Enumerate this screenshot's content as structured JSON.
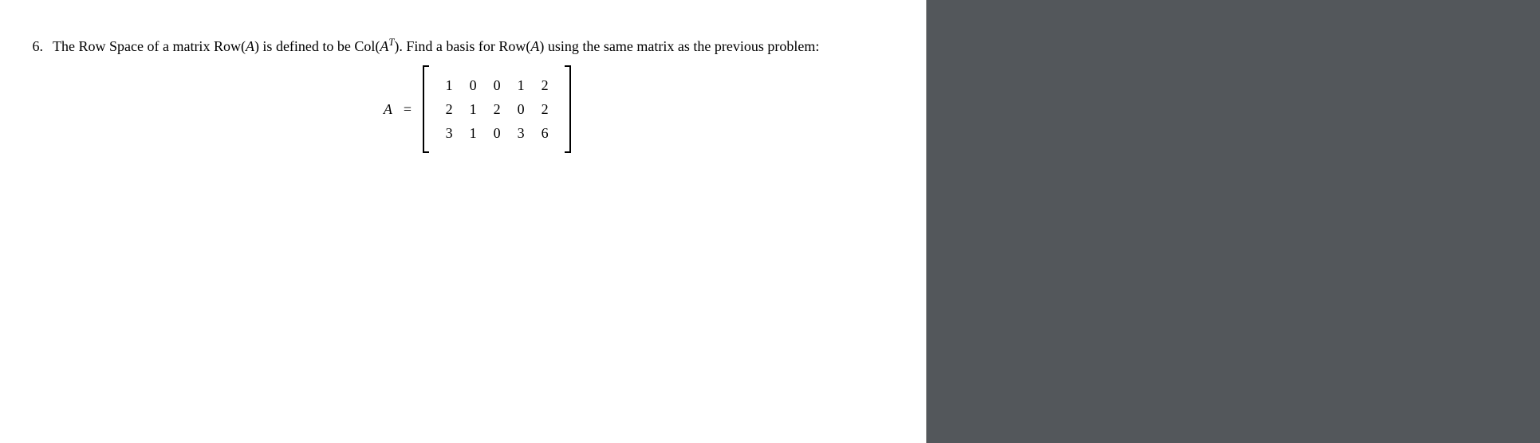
{
  "problem": {
    "number": "6.",
    "text_part1": "The Row Space of a matrix Row(",
    "var_A1": "A",
    "text_part2": ") is defined to be Col(",
    "var_A2": "A",
    "sup_T": "T",
    "text_part3": "). Find a basis for Row(",
    "var_A3": "A",
    "text_part4": ") using the same matrix as the previous problem:"
  },
  "equation": {
    "lhs": "A",
    "eq": "=",
    "matrix": {
      "rows": [
        [
          "1",
          "0",
          "0",
          "1",
          "2"
        ],
        [
          "2",
          "1",
          "2",
          "0",
          "2"
        ],
        [
          "3",
          "1",
          "0",
          "3",
          "6"
        ]
      ]
    }
  }
}
